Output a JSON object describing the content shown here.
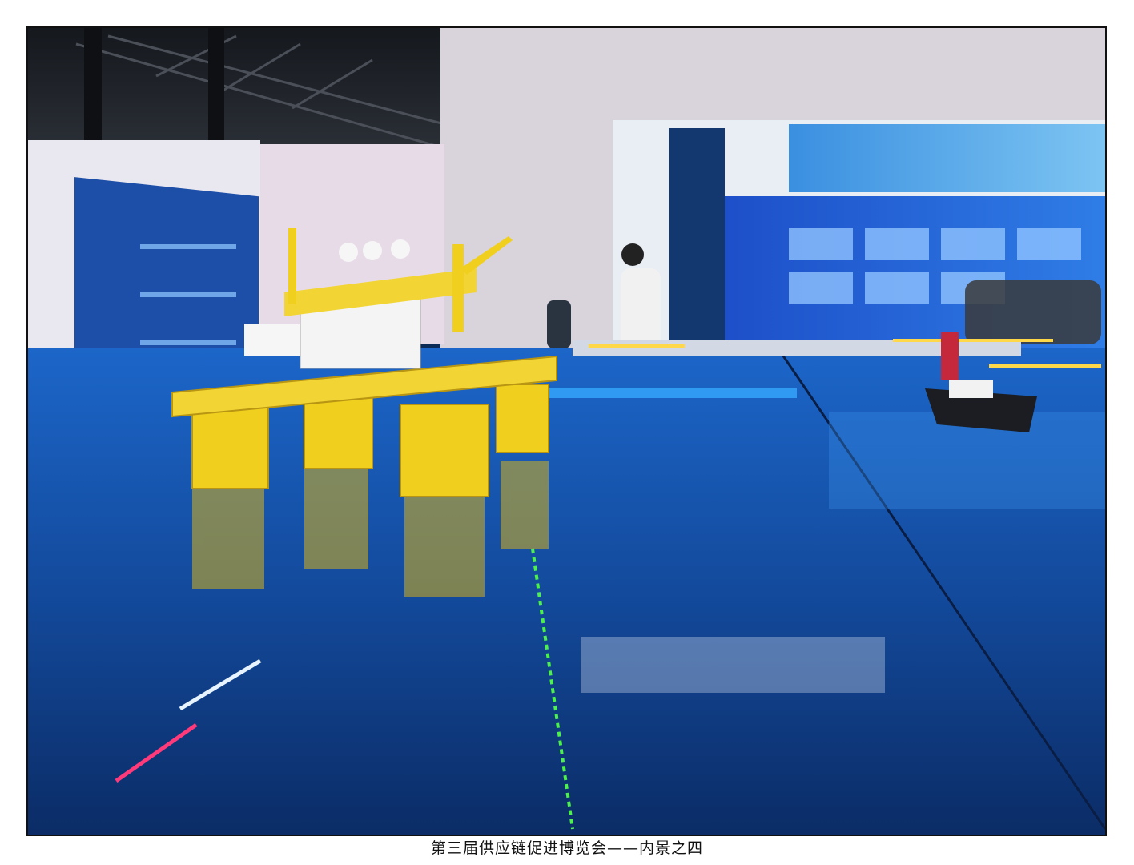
{
  "photo": {
    "subject": "offshore-platform-model-exhibit"
  },
  "caption": {
    "text": "第三届供应链促进博览会——内景之四"
  },
  "colors": {
    "water": "#1553b8",
    "platform": "#f0cf1e",
    "display": "#1d5ed8",
    "ceiling": "#1b1f26"
  }
}
